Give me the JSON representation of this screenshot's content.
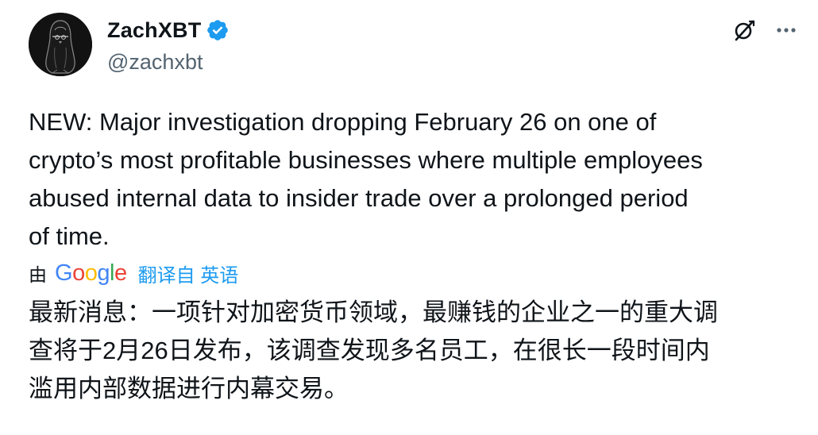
{
  "author": {
    "display_name": "ZachXBT",
    "handle": "@zachxbt",
    "verified": true,
    "verified_color": "#1d9bf0"
  },
  "actions": {
    "grok_icon": "grok-icon",
    "more_icon": "more-horizontal-icon"
  },
  "tweet": {
    "text": "NEW: Major investigation dropping February 26 on one of\ncrypto’s most profitable businesses where multiple employees\nabused internal data to insider trade over a prolonged period\nof time."
  },
  "translation": {
    "by_label": "由",
    "provider": "Google",
    "link_label": "翻译自 英语",
    "link_color": "#1d9bf0",
    "text": "最新消息：一项针对加密货币领域，最赚钱的企业之一的重大调\n查将于2月26日发布，该调查发现多名员工，在很长一段时间内\n滥用内部数据进行内幕交易。"
  }
}
